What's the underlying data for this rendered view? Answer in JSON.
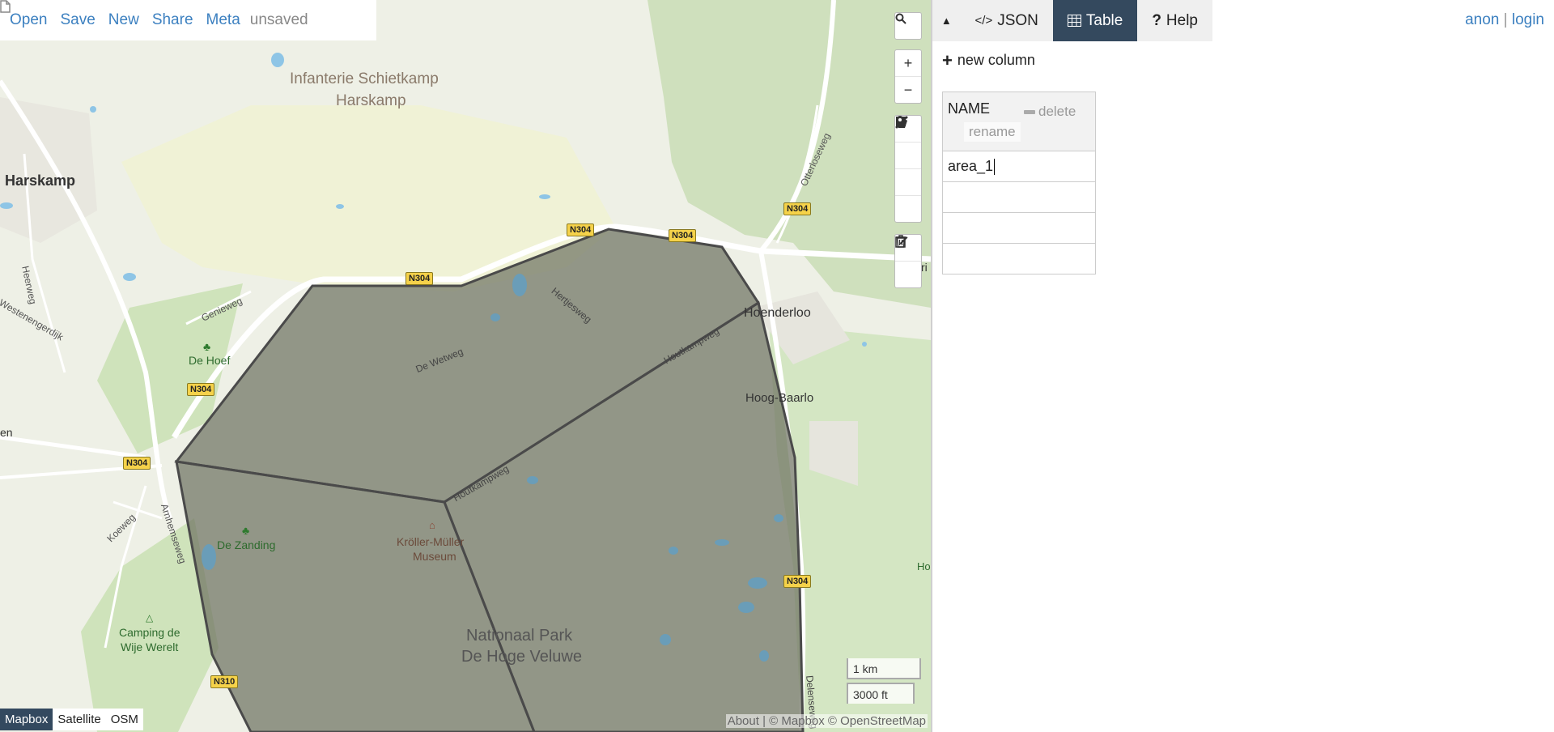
{
  "file_menu": {
    "items": [
      "Open",
      "Save",
      "New",
      "Share",
      "Meta"
    ],
    "status": "unsaved"
  },
  "map": {
    "labels": {
      "harskamp": "Harskamp",
      "infanterie_1": "Infanterie Schietkamp",
      "infanterie_2": "Harskamp",
      "de_hoef": "De Hoef",
      "hoenderloo": "Hoenderloo",
      "hoog_baarlo": "Hoog-Baarlo",
      "de_zanding": "De Zanding",
      "kroller_1": "Kröller-Müller",
      "kroller_2": "Museum",
      "camping_1": "Camping de",
      "camping_2": "Wije Werelt",
      "park_1": "Nationaal Park",
      "park_2": "De Hoge Veluwe",
      "genieweg": "Genieweg",
      "heerweg": "Heerweg",
      "westenengerdijk": "Westenengerdijk",
      "de_wetweg": "De Wetweg",
      "hertjesweg": "Hertjesweg",
      "houtkampweg": "Houtkampweg",
      "koeweg": "Koeweg",
      "arnhemseweg": "Arnhemseweg",
      "otterloseweg": "Otterloseweg",
      "delenseweg": "Delenseweg",
      "en_partial": "en",
      "ri_partial": "ri",
      "ho_partial": "Ho"
    },
    "road_shields": [
      "N304",
      "N304",
      "N304",
      "N304",
      "N304",
      "N304",
      "N304",
      "N310"
    ],
    "scale": {
      "metric": "1 km",
      "imperial": "3000 ft"
    },
    "layers": [
      "Mapbox",
      "Satellite",
      "OSM"
    ],
    "active_layer": "Mapbox",
    "attribution": "About | © Mapbox © OpenStreetMap",
    "polygon_fill": "#6f7362",
    "colors": {
      "accent": "#3c80c0",
      "dark_tab": "#34495e"
    }
  },
  "map_controls": {
    "search": "search-icon",
    "zoom_in": "+",
    "zoom_out": "−"
  },
  "panel": {
    "tabs": [
      {
        "label": "JSON",
        "icon": "code-icon"
      },
      {
        "label": "Table",
        "icon": "table-icon"
      },
      {
        "label": "Help",
        "icon": "question-icon"
      }
    ],
    "active_tab": "Table",
    "auth": {
      "anon": "anon",
      "separator": "|",
      "login": "login"
    },
    "new_column": "new column",
    "table": {
      "column": {
        "name": "NAME",
        "delete": "delete",
        "rename": "rename"
      },
      "rows": [
        "area_1",
        "",
        "",
        ""
      ]
    }
  }
}
